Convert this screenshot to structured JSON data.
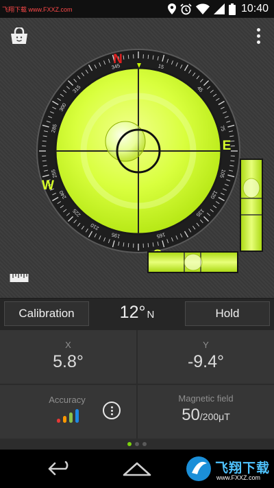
{
  "status_bar": {
    "watermark": "飞翔下载 www.FXXZ.com",
    "time": "10:40",
    "icons": [
      "location-icon",
      "alarm-icon",
      "wifi-icon",
      "cell-signal-icon",
      "battery-icon"
    ]
  },
  "compass": {
    "cardinals": {
      "north": "N",
      "east": "E",
      "south": "S",
      "west": "W"
    },
    "degree_labels": [
      "15",
      "45",
      "75",
      "105",
      "120",
      "135",
      "165",
      "195",
      "210",
      "225",
      "240",
      "255",
      "285",
      "300",
      "315",
      "345"
    ],
    "heading_marker_color": "#c8ff00"
  },
  "colors": {
    "bubble_fill": "#d6ff3a",
    "cardinal_north": "#e02020",
    "cardinal_other": "#d7ff2a"
  },
  "controls": {
    "calibration_label": "Calibration",
    "hold_label": "Hold",
    "heading_value": "12°",
    "heading_direction": "N"
  },
  "readouts": {
    "x_label": "X",
    "x_value": "5.8°",
    "y_label": "Y",
    "y_value": "-9.4°",
    "accuracy_label": "Accuracy",
    "magnetic_label": "Magnetic field",
    "magnetic_value": "50",
    "magnetic_max": "/200μT"
  },
  "pager": {
    "pages": 3,
    "active": 0
  },
  "watermark_bottom": {
    "text1": "飞翔下载",
    "text2": "www.FXXZ.com"
  }
}
